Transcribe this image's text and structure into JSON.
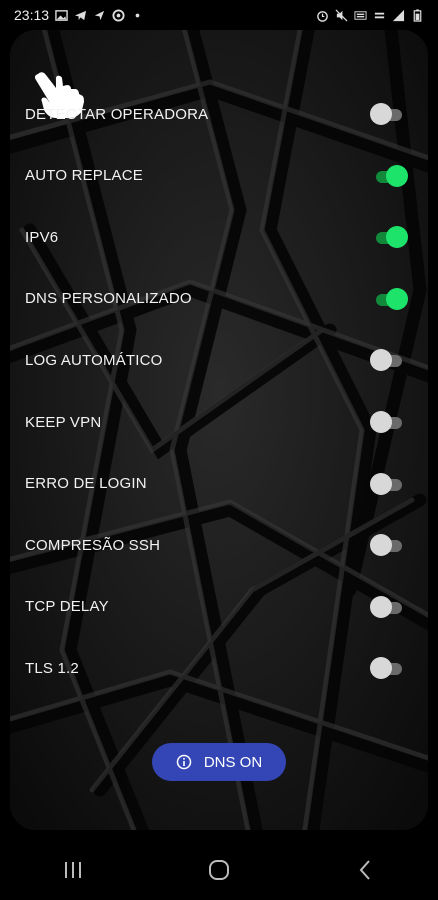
{
  "status_bar": {
    "time": "23:13",
    "left_icons": [
      "gallery-icon",
      "telegram-icon",
      "location-icon",
      "vpn-icon",
      "dot-icon"
    ],
    "right_icons": [
      "alarm-icon",
      "mute-icon",
      "volte-icon",
      "lte-icon",
      "signal-icon",
      "battery-icon"
    ]
  },
  "header": {
    "icon": "pointing-hand-icon"
  },
  "settings": [
    {
      "label": "DETECTAR OPERADORA",
      "on": false
    },
    {
      "label": "AUTO REPLACE",
      "on": true
    },
    {
      "label": "IPV6",
      "on": true
    },
    {
      "label": "DNS PERSONALIZADO",
      "on": true
    },
    {
      "label": "LOG AUTOMÁTICO",
      "on": false
    },
    {
      "label": "KEEP VPN",
      "on": false
    },
    {
      "label": "ERRO DE LOGIN",
      "on": false
    },
    {
      "label": "COMPRESÃO SSH",
      "on": false
    },
    {
      "label": "TCP DELAY",
      "on": false
    },
    {
      "label": "TLS 1.2",
      "on": false
    }
  ],
  "dns_button": {
    "label": "DNS ON",
    "icon": "info-icon",
    "color": "#3446b6"
  },
  "nav_bar": {
    "buttons": [
      "recent-apps-icon",
      "home-icon",
      "back-icon"
    ]
  },
  "colors": {
    "toggle_on": "#1ee36a",
    "toggle_off": "#d8d8d8",
    "background": "#000000"
  }
}
